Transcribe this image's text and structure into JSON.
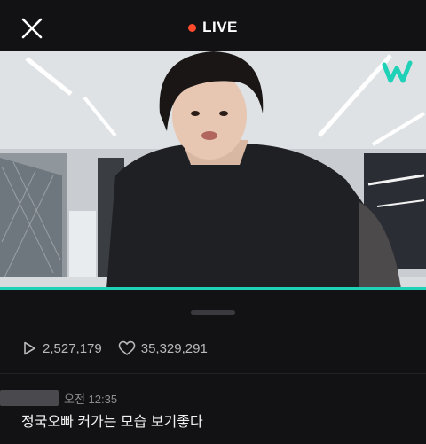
{
  "header": {
    "live_label": "LIVE",
    "live_dot_color": "#ff4b2b",
    "close_icon": "close-icon"
  },
  "player": {
    "watermark_icon": "weverse-logo",
    "progress_color": "#1fd1b6",
    "progress_fraction": 1.0
  },
  "stats": {
    "plays": "2,527,179",
    "plays_icon": "play-icon",
    "likes": "35,329,291",
    "likes_icon": "heart-icon"
  },
  "comments": [
    {
      "time": "오전 12:35",
      "text": "정국오빠 커가는 모습 보기좋다"
    }
  ]
}
